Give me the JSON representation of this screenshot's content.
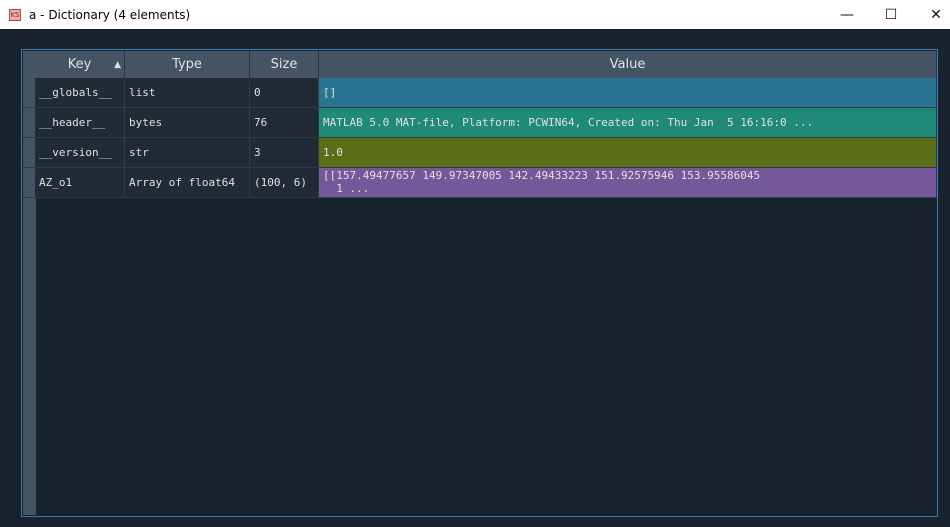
{
  "window": {
    "title": "a - Dictionary (4 elements)",
    "minimize": "—",
    "maximize": "☐",
    "close": "✕"
  },
  "table": {
    "headers": {
      "key": "Key",
      "type": "Type",
      "size": "Size",
      "value": "Value",
      "sort_indicator": "▲"
    },
    "rows": [
      {
        "key": "__globals__",
        "type": "list",
        "size": "0",
        "value": "[]",
        "color": "#2b7592"
      },
      {
        "key": "__header__",
        "type": "bytes",
        "size": "76",
        "value": "MATLAB 5.0 MAT-file, Platform: PCWIN64, Created on: Thu Jan  5 16:16:0 ...",
        "color": "#1f8a78"
      },
      {
        "key": "__version__",
        "type": "str",
        "size": "3",
        "value": "1.0",
        "color": "#5a6e17"
      },
      {
        "key": "AZ_o1",
        "type": "Array of float64",
        "size": "(100, 6)",
        "value": "[[157.49477657 149.97347005 142.49433223 151.92575946 153.95586045\n  1 ...",
        "color": "#74589a"
      }
    ]
  }
}
